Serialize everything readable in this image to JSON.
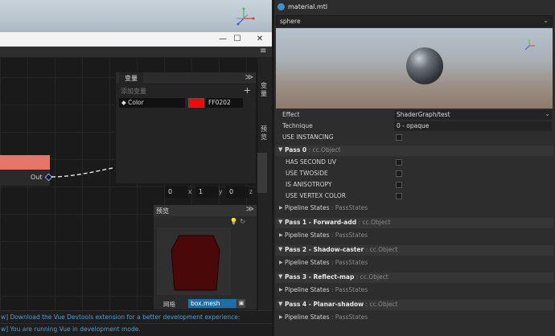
{
  "left": {
    "window_controls": {
      "minimize": "—",
      "maximize": "☐",
      "close": "✕"
    },
    "tool_menu_icon": "≡",
    "node": {
      "out_label": "Out"
    },
    "variables_panel": {
      "tab": "变量",
      "collapse": "≫",
      "add_label": "添加变量",
      "add_button": "+",
      "var_name": "◆ Color",
      "var_hex": "FF0202",
      "var_color": "#ff0202"
    },
    "xyz": {
      "x_value": "0",
      "x_label": "x",
      "y_value": "1",
      "y_label": "y",
      "z_value": "0",
      "z_label": "z"
    },
    "side_tabs": {
      "tab1": "变量",
      "tab2": "预览"
    },
    "preview_panel": {
      "title": "预览",
      "collapse": "≫",
      "icons": "💡 ↻",
      "mesh_label": "网格",
      "mesh_value": "box.mesh",
      "mesh_btn": "▣",
      "mesh_color": "#4a0808"
    },
    "console": {
      "line1": "w] Download the Vue Devtools extension for a better development experience:",
      "line2": "w] You are running Vue in development mode."
    }
  },
  "inspector": {
    "title": "material.mtl",
    "mesh_select": "sphere",
    "chevron": "⌄",
    "props": {
      "effect_label": "Effect",
      "effect_value": "ShaderGraph/test",
      "technique_label": "Technique",
      "technique_value": "0 - opaque",
      "instancing_label": "USE INSTANCING"
    },
    "pass0": {
      "name": "Pass 0",
      "type": " : cc.Object",
      "opt1": "HAS SECOND UV",
      "opt2": "USE TWOSIDE",
      "opt3": "IS ANISOTROPY",
      "opt4": "USE VERTEX COLOR",
      "pipeline": "Pipeline States",
      "pipeline_type": " : PassStates"
    },
    "pass1": {
      "name": "Pass 1 - Forward-add",
      "type": " : cc.Object",
      "pipeline": "Pipeline States",
      "pipeline_type": " : PassStates"
    },
    "pass2": {
      "name": "Pass 2 - Shadow-caster",
      "type": " : cc.Object",
      "pipeline": "Pipeline States",
      "pipeline_type": " : PassStates"
    },
    "pass3": {
      "name": "Pass 3 - Reflect-map",
      "type": " : cc.Object",
      "pipeline": "Pipeline States",
      "pipeline_type": " : PassStates"
    },
    "pass4": {
      "name": "Pass 4 - Planar-shadow",
      "type": " : cc.Object",
      "pipeline": "Pipeline States",
      "pipeline_type": " : PassStates"
    }
  }
}
